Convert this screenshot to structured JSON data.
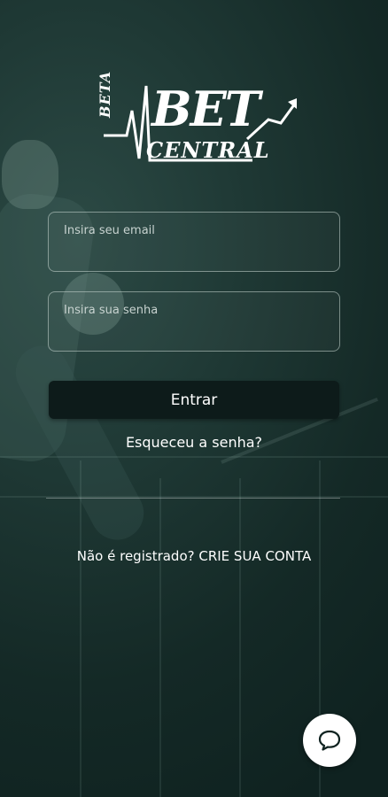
{
  "logo": {
    "beta": "BETA",
    "bet": "BET",
    "central": "CENTRAL"
  },
  "login": {
    "email_placeholder": "Insira seu email",
    "password_placeholder": "Insira sua senha",
    "submit_label": "Entrar",
    "forgot_password": "Esqueceu a senha?",
    "register_prompt": "Não é registrado? CRIE SUA CONTA"
  },
  "chat": {
    "icon": "chat-bubble-icon"
  },
  "colors": {
    "background": "#1f3935",
    "button": "#0d1b1a",
    "text": "#ffffff"
  }
}
